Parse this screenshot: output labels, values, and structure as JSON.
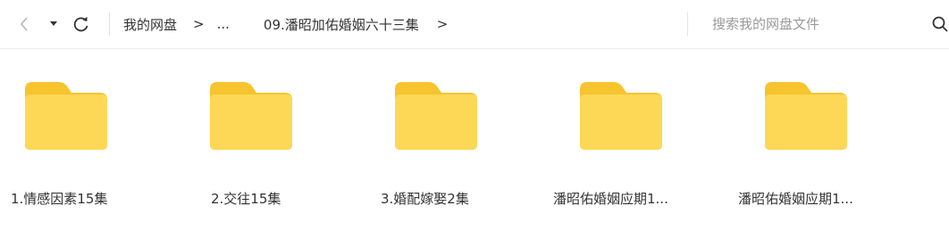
{
  "toolbar": {
    "back_icon": "chevron-left-icon",
    "dropdown_icon": "caret-down-icon",
    "refresh_icon": "refresh-icon"
  },
  "breadcrumb": {
    "root": "我的网盘",
    "separator": ">",
    "ellipsis": "...",
    "current": "09.潘昭加佑婚姻六十三集",
    "trailing_separator": ">"
  },
  "search": {
    "placeholder": "搜索我的网盘文件",
    "icon": "search-icon"
  },
  "files": [
    {
      "name": "1.情感因素15集",
      "type": "folder"
    },
    {
      "name": "2.交往15集",
      "type": "folder"
    },
    {
      "name": "3.婚配嫁娶2集",
      "type": "folder"
    },
    {
      "name": "潘昭佑婚姻应期1...",
      "type": "folder"
    },
    {
      "name": "潘昭佑婚姻应期1...",
      "type": "folder"
    }
  ],
  "colors": {
    "folder_back": "#f7c430",
    "folder_front": "#fdd857",
    "text": "#333333",
    "placeholder": "#9a9a9a",
    "divider": "#ededed"
  }
}
